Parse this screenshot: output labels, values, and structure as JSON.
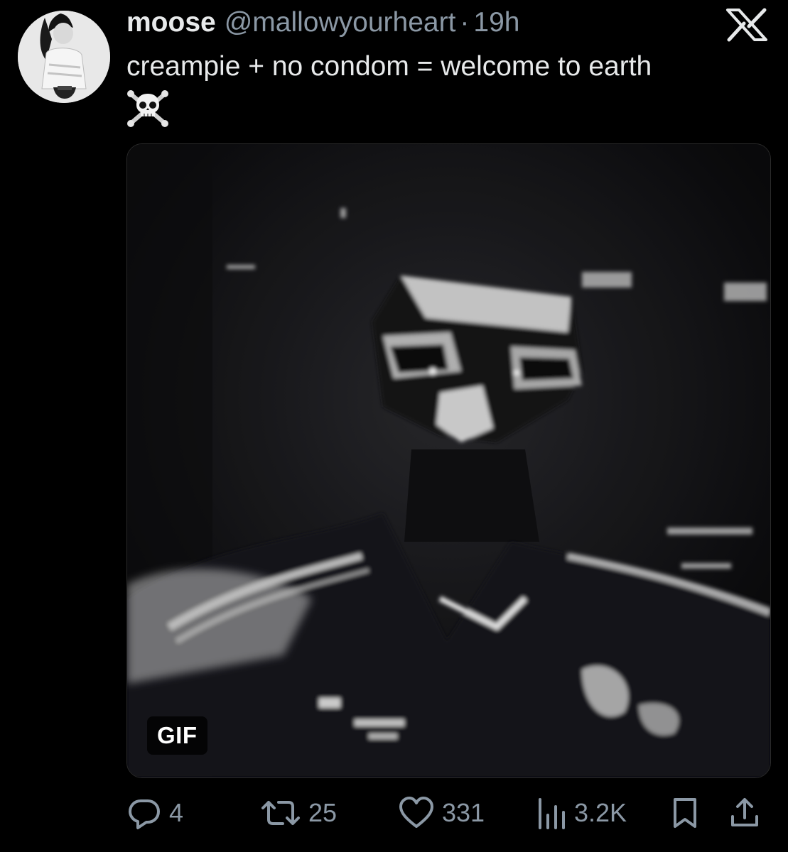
{
  "tweet": {
    "display_name": "moose",
    "handle": "@mallowyourheart",
    "separator": "·",
    "time": "19h",
    "text": "creampie + no condom = welcome to earth",
    "emoji_icon": "skull-and-crossbones-icon"
  },
  "media": {
    "badge": "GIF"
  },
  "actions": {
    "replies": "4",
    "reposts": "25",
    "likes": "331",
    "views": "3.2K"
  },
  "colors": {
    "background": "#000000",
    "text_primary": "#e7e9ea",
    "text_secondary": "#8b98a5"
  }
}
